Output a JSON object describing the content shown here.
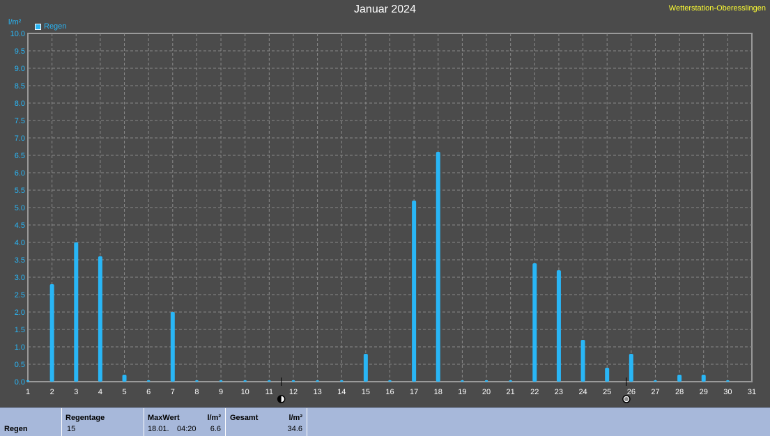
{
  "header": {
    "title": "Januar 2024",
    "station": "Wetterstation-Oberesslingen",
    "unit": "l/m²"
  },
  "legend": {
    "label": "Regen"
  },
  "chart_data": {
    "type": "bar",
    "title": "Januar 2024",
    "ylabel": "l/m²",
    "xlabel": "",
    "ylim": [
      0,
      10
    ],
    "xlim": [
      1,
      31
    ],
    "grid": true,
    "legend_position": "top-left",
    "y_ticks": [
      "0.0",
      "0.5",
      "1.0",
      "1.5",
      "2.0",
      "2.5",
      "3.0",
      "3.5",
      "4.0",
      "4.5",
      "5.0",
      "5.5",
      "6.0",
      "6.5",
      "7.0",
      "7.5",
      "8.0",
      "8.5",
      "9.0",
      "9.5",
      "10.0"
    ],
    "x_ticks": [
      1,
      2,
      3,
      4,
      5,
      6,
      7,
      8,
      9,
      10,
      11,
      12,
      13,
      14,
      15,
      16,
      17,
      18,
      19,
      20,
      21,
      22,
      23,
      24,
      25,
      26,
      27,
      28,
      29,
      30,
      31
    ],
    "moon_phases": [
      {
        "phase": "last-quarter",
        "day": 11.5
      },
      {
        "phase": "new-moon",
        "day": 25.8
      }
    ],
    "series": [
      {
        "name": "Regen",
        "color": "#29b6f6",
        "x": [
          1,
          2,
          3,
          4,
          5,
          6,
          7,
          8,
          9,
          10,
          11,
          12,
          13,
          14,
          15,
          16,
          17,
          18,
          19,
          20,
          21,
          22,
          23,
          24,
          25,
          26,
          27,
          28,
          29,
          30
        ],
        "values": [
          0,
          2.8,
          4.0,
          3.6,
          0.2,
          0,
          2.0,
          0,
          0,
          0,
          0,
          0,
          0,
          0,
          0.8,
          0,
          5.2,
          6.6,
          0,
          0,
          0,
          3.4,
          3.2,
          1.2,
          0.4,
          0.8,
          0,
          0.2,
          0.2,
          0
        ]
      }
    ]
  },
  "footer": {
    "row_label": "Regen",
    "regentage_label": "Regentage",
    "regentage_value": "15",
    "maxwert_label": "MaxWert",
    "maxwert_unit": "l/m²",
    "maxwert_date": "18.01.",
    "maxwert_time": "04:20",
    "maxwert_value": "6.6",
    "gesamt_label": "Gesamt",
    "gesamt_unit": "l/m²",
    "gesamt_value": "34.6"
  }
}
